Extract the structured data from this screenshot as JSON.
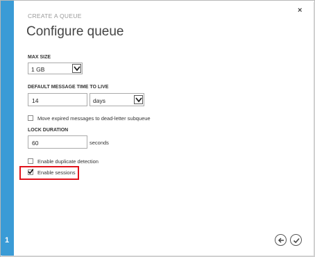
{
  "wizard": {
    "breadcrumb": "CREATE A QUEUE",
    "title": "Configure queue",
    "step_number": "1",
    "close_glyph": "×"
  },
  "fields": {
    "max_size": {
      "label": "MAX SIZE",
      "value": "1 GB"
    },
    "ttl": {
      "label": "DEFAULT MESSAGE TIME TO LIVE",
      "value": "14",
      "unit_value": "days"
    },
    "move_expired": {
      "label": "Move expired messages to dead-letter subqueue",
      "checked": false
    },
    "lock_duration": {
      "label": "LOCK DURATION",
      "value": "60",
      "unit": "seconds"
    },
    "duplicate_detection": {
      "label": "Enable duplicate detection",
      "checked": false
    },
    "sessions": {
      "label": "Enable sessions",
      "checked": true
    }
  },
  "colors": {
    "stripe": "#3a9bd6",
    "highlight": "#e0121b"
  },
  "icons": {
    "back": "back-arrow-icon",
    "finish": "checkmark-icon",
    "close": "close-icon",
    "dropdown": "chevron-down-icon"
  }
}
